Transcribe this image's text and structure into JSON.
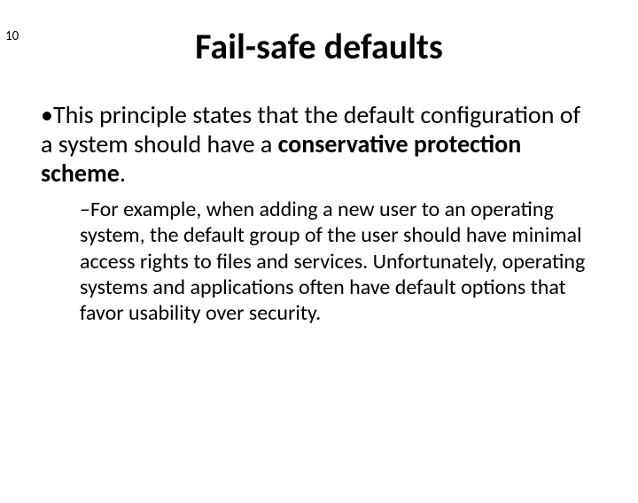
{
  "page_number": "10",
  "title": "Fail-safe defaults",
  "bullet1": {
    "mark": "•",
    "text_plain": "This principle states that the default configuration of a system should have a ",
    "text_bold": "conservative protection scheme",
    "text_tail": "."
  },
  "bullet2": {
    "dash": "–",
    "text": "For example, when adding a new user to an operating system, the default group of the user should have minimal access rights to files and services. Unfortunately, operating systems and applications often have default options that favor usability over security."
  }
}
